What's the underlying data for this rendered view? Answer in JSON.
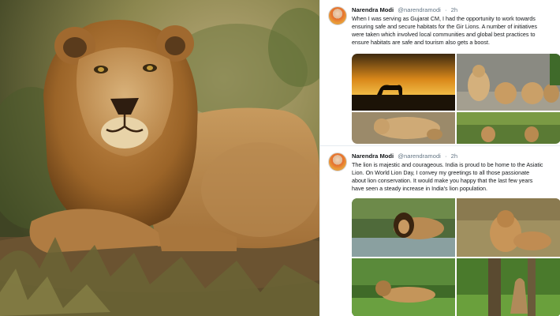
{
  "photo": {
    "subject": "asiatic-lion-resting"
  },
  "tweets": [
    {
      "author_name": "Narendra Modi",
      "author_handle": "@narendramodi",
      "separator": "·",
      "time": "2h",
      "lines": [
        "When I was serving as Gujarat CM, I had the opportunity to work towards",
        "ensuring safe and secure habitats for the Gir Lions. A number of initiatives",
        "were taken which involved local communities and global best practices to",
        "ensure habitats are safe and tourism also gets a boost."
      ],
      "media": [
        "lion-sunset-silhouette",
        "lion-cubs-group",
        "lioness-with-cubs",
        "lions-in-forest"
      ]
    },
    {
      "author_name": "Narendra Modi",
      "author_handle": "@narendramodi",
      "separator": "·",
      "time": "2h",
      "lines": [
        "The lion is majestic and courageous. India is proud to be home to the Asiatic",
        "Lion. On World Lion Day, I convey my greetings to all those passionate",
        "about lion conservation. It would make you happy that the last few years",
        "have seen a steady increase in India's lion population."
      ],
      "media": [
        "lion-by-water",
        "lion-sitting-grass",
        "lion-lying-green",
        "lion-between-trees"
      ]
    }
  ],
  "colors": {
    "name": "#14171a",
    "handle": "#657786",
    "divider": "#e6ecf0"
  }
}
